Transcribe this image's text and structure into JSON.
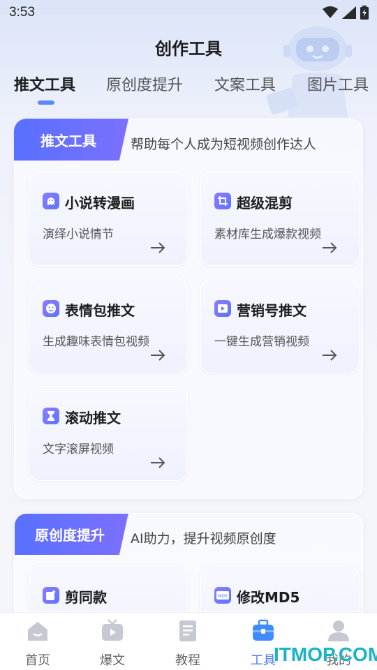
{
  "status_bar": {
    "time": "3:53",
    "icons": [
      "wifi-icon",
      "signal-icon",
      "battery-icon"
    ]
  },
  "header": {
    "title": "创作工具"
  },
  "tabs": [
    {
      "label": "推文工具",
      "active": true
    },
    {
      "label": "原创度提升",
      "active": false
    },
    {
      "label": "文案工具",
      "active": false
    },
    {
      "label": "图片工具",
      "active": false
    }
  ],
  "sections": [
    {
      "tag": "推文工具",
      "description": "帮助每个人成为短视频创作达人",
      "cards": [
        {
          "icon": "ghost-book-icon",
          "title": "小说转漫画",
          "subtitle": "演绎小说情节"
        },
        {
          "icon": "crop-icon",
          "title": "超级混剪",
          "subtitle": "素材库生成爆款视频"
        },
        {
          "icon": "smiley-icon",
          "title": "表情包推文",
          "subtitle": "生成趣味表情包视频"
        },
        {
          "icon": "video-play-icon",
          "title": "营销号推文",
          "subtitle": "一键生成营销视频"
        },
        {
          "icon": "hourglass-icon",
          "title": "滚动推文",
          "subtitle": "文字滚屏视频"
        }
      ]
    },
    {
      "tag": "原创度提升",
      "description": "AI助力，提升视频原创度",
      "cards": [
        {
          "icon": "sparkle-edit-icon",
          "title": "剪同款",
          "subtitle": ""
        },
        {
          "icon": "md5-icon",
          "title": "修改MD5",
          "subtitle": ""
        }
      ]
    }
  ],
  "bottom_nav": [
    {
      "label": "首页",
      "icon": "home-icon",
      "active": false
    },
    {
      "label": "爆文",
      "icon": "tv-icon",
      "active": false
    },
    {
      "label": "教程",
      "icon": "document-icon",
      "active": false
    },
    {
      "label": "工具",
      "icon": "toolbox-icon",
      "active": true
    },
    {
      "label": "我的",
      "icon": "user-icon",
      "active": false
    }
  ],
  "watermark": "ITMOP.COM",
  "colors": {
    "accent": "#5870ff",
    "active_nav": "#4e7bff",
    "watermark": "#19b3c8"
  }
}
